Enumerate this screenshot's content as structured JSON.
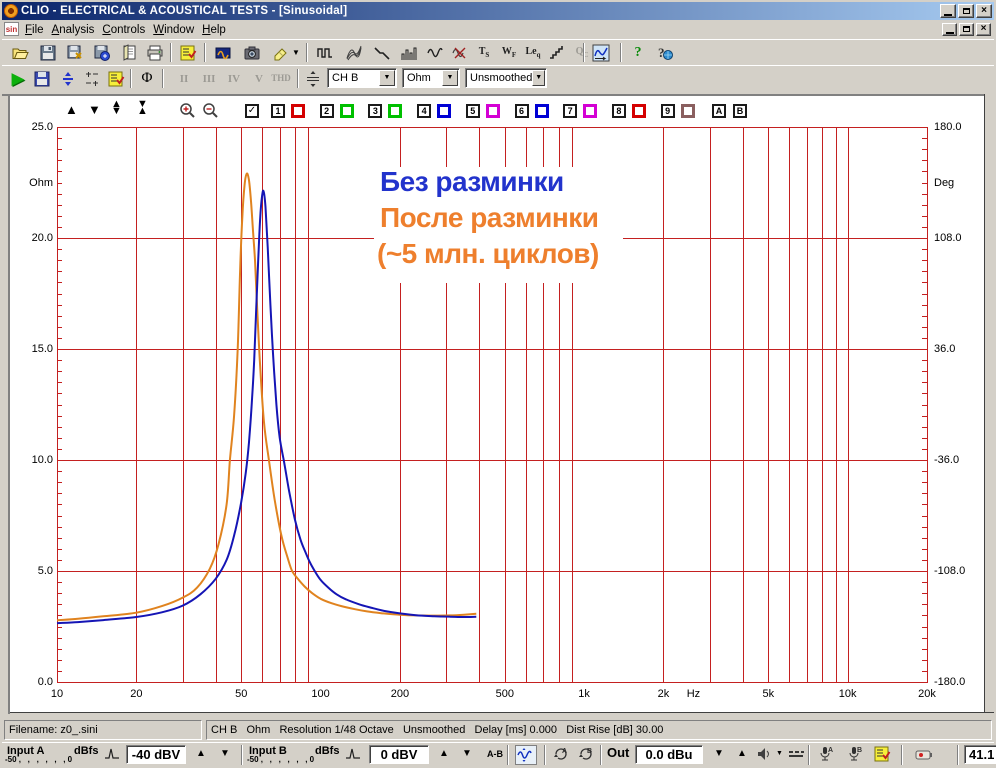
{
  "window": {
    "title": "CLIO - ELECTRICAL & ACOUSTICAL TESTS - [Sinusoidal]"
  },
  "menu": {
    "items": [
      "File",
      "Analysis",
      "Controls",
      "Window",
      "Help"
    ]
  },
  "toolbar1": {
    "icons": [
      "open-document",
      "save-file",
      "save-as",
      "export-file",
      "print-preview",
      "print",
      "measurement-notes",
      "multimeter",
      "snapshot",
      "erase",
      "erase-dropdown",
      "mls-analysis",
      "waterfall-analysis",
      "decay-analysis",
      "rta-analysis",
      "sinusoidal-analysis",
      "distortion-analysis",
      "t-s-parameters",
      "wow-flutter",
      "leq-analysis",
      "linearity-steps",
      "quality-control",
      "sinusoidal-active",
      "help",
      "help-about"
    ],
    "text_icons": {
      "ts": "Ts",
      "wf": "WF",
      "leq": "Leq",
      "qc": "Qc"
    }
  },
  "toolbar2": {
    "icons": [
      "start-measurement",
      "autosave",
      "autoscale",
      "scale-settings",
      "sin-settings",
      "phase",
      "harmonic-2",
      "harmonic-3",
      "harmonic-4",
      "harmonic-5",
      "thd",
      "split-scale"
    ],
    "text_icons": {
      "h2": "II",
      "h3": "III",
      "h4": "IV",
      "h5": "V",
      "thd": "THD"
    },
    "combos": {
      "channel": "CH B",
      "unit": "Ohm",
      "smoothing": "Unsmoothed"
    }
  },
  "chart_toolbar": {
    "curve_slots": [
      {
        "num": "1",
        "color": "#d40000"
      },
      {
        "num": "2",
        "color": "#00c000"
      },
      {
        "num": "3",
        "color": "#00c000"
      },
      {
        "num": "4",
        "color": "#0000d4"
      },
      {
        "num": "5",
        "color": "#d400d4"
      },
      {
        "num": "6",
        "color": "#0000d4"
      },
      {
        "num": "7",
        "color": "#d400d4"
      },
      {
        "num": "8",
        "color": "#d40000"
      },
      {
        "num": "9",
        "color": "#8a5f5f"
      }
    ],
    "ab_slots": [
      "A",
      "B"
    ],
    "check_all": "✓"
  },
  "chart_data": {
    "type": "line",
    "x_axis": {
      "label": "Hz",
      "scale": "log",
      "min": 10,
      "max": 20000,
      "display_labels": [
        {
          "text": "10",
          "f": 10
        },
        {
          "text": "20",
          "f": 20
        },
        {
          "text": "50",
          "f": 50
        },
        {
          "text": "100",
          "f": 100
        },
        {
          "text": "200",
          "f": 200
        },
        {
          "text": "500",
          "f": 500
        },
        {
          "text": "1k",
          "f": 1000
        },
        {
          "text": "2k",
          "f": 2000
        },
        {
          "text": "Hz",
          "f": 2600
        },
        {
          "text": "5k",
          "f": 5000
        },
        {
          "text": "10k",
          "f": 10000
        },
        {
          "text": "20k",
          "f": 20000
        }
      ]
    },
    "y_left": {
      "label": "Ohm",
      "min": 0,
      "max": 25,
      "labels": [
        {
          "text": "25.0",
          "v": 25
        },
        {
          "text": "20.0",
          "v": 20
        },
        {
          "text": "15.0",
          "v": 15
        },
        {
          "text": "10.0",
          "v": 10
        },
        {
          "text": "5.0",
          "v": 5
        },
        {
          "text": "0.0",
          "v": 0
        }
      ]
    },
    "y_right": {
      "label": "Deg",
      "min": -180,
      "max": 180,
      "labels": [
        {
          "text": "180.0",
          "v": 180
        },
        {
          "text": "108.0",
          "v": 108
        },
        {
          "text": "36.0",
          "v": 36
        },
        {
          "text": "-36.0",
          "v": -36
        },
        {
          "text": "-108.0",
          "v": -108
        },
        {
          "text": "-180.0",
          "v": -180
        }
      ]
    },
    "grid_color": "#c42020",
    "series": [
      {
        "name": "После разминки (~5 млн. циклов)",
        "color": "#e0831f",
        "points": [
          [
            10,
            2.78
          ],
          [
            12,
            2.85
          ],
          [
            15,
            2.96
          ],
          [
            20,
            3.12
          ],
          [
            25,
            3.42
          ],
          [
            30,
            3.8
          ],
          [
            34,
            4.25
          ],
          [
            38,
            5.1
          ],
          [
            41,
            6.2
          ],
          [
            44,
            8.0
          ],
          [
            45.3,
            10
          ],
          [
            47,
            12
          ],
          [
            48.5,
            15
          ],
          [
            49.5,
            18.5
          ],
          [
            50.5,
            21
          ],
          [
            51.5,
            22.4
          ],
          [
            52.5,
            22.9
          ],
          [
            53.5,
            22.6
          ],
          [
            54.5,
            21.6
          ],
          [
            55.5,
            20.2
          ],
          [
            56.4,
            19
          ],
          [
            57.5,
            16.8
          ],
          [
            59,
            14.2
          ],
          [
            61,
            11.7
          ],
          [
            63.7,
            10
          ],
          [
            67,
            8.2
          ],
          [
            71,
            6.6
          ],
          [
            75,
            5.6
          ],
          [
            78,
            5.0
          ],
          [
            82,
            4.65
          ],
          [
            87,
            4.3
          ],
          [
            93,
            4.0
          ],
          [
            100,
            3.75
          ],
          [
            110,
            3.55
          ],
          [
            120,
            3.42
          ],
          [
            135,
            3.28
          ],
          [
            150,
            3.18
          ],
          [
            170,
            3.1
          ],
          [
            200,
            3.03
          ],
          [
            230,
            3.0
          ],
          [
            270,
            2.99
          ],
          [
            310,
            3.0
          ],
          [
            350,
            3.03
          ],
          [
            390,
            3.07
          ]
        ]
      },
      {
        "name": "Без разминки",
        "color": "#1515b5",
        "points": [
          [
            10,
            2.65
          ],
          [
            12,
            2.7
          ],
          [
            15,
            2.79
          ],
          [
            20,
            2.93
          ],
          [
            25,
            3.14
          ],
          [
            30,
            3.44
          ],
          [
            35,
            3.95
          ],
          [
            40,
            4.65
          ],
          [
            44,
            5.5
          ],
          [
            47,
            6.6
          ],
          [
            50,
            8.1
          ],
          [
            52,
            9.4
          ],
          [
            53.5,
            10.8
          ],
          [
            55,
            12.8
          ],
          [
            56,
            14.5
          ],
          [
            57,
            16.8
          ],
          [
            58,
            19
          ],
          [
            59,
            20.9
          ],
          [
            60,
            21.9
          ],
          [
            60.8,
            22.1
          ],
          [
            61.8,
            21.4
          ],
          [
            63,
            19.6
          ],
          [
            64.5,
            17
          ],
          [
            66,
            14.8
          ],
          [
            68,
            12.5
          ],
          [
            70,
            11
          ],
          [
            73,
            9.8
          ],
          [
            76,
            8.6
          ],
          [
            80,
            7.3
          ],
          [
            84,
            6.4
          ],
          [
            88,
            5.8
          ],
          [
            91,
            5.4
          ],
          [
            95,
            5.0
          ],
          [
            100,
            4.6
          ],
          [
            107,
            4.25
          ],
          [
            115,
            3.95
          ],
          [
            125,
            3.72
          ],
          [
            140,
            3.5
          ],
          [
            155,
            3.35
          ],
          [
            175,
            3.2
          ],
          [
            200,
            3.09
          ],
          [
            230,
            3.01
          ],
          [
            270,
            2.96
          ],
          [
            310,
            2.94
          ],
          [
            350,
            2.93
          ],
          [
            390,
            2.94
          ]
        ]
      }
    ]
  },
  "annotations": {
    "line1": {
      "text": "Без разминки",
      "color": "#2233cc"
    },
    "line2": {
      "text": "После разминки",
      "color": "#ee7f2d"
    },
    "line3": {
      "text": "(~5 млн. циклов)",
      "color": "#ee7f2d"
    }
  },
  "status": {
    "filename": "Filename: z0_.sini",
    "info": "CH B   Ohm   Resolution 1/48 Octave   Unsmoothed   Delay [ms] 0.000   Dist Rise [dB] 30.00"
  },
  "bottom": {
    "input_a": {
      "label": "Input A",
      "unit": "dBfs",
      "scale": "-50 ,   ,   ,   ,   ,   , 0",
      "value": "-40 dBV"
    },
    "input_b": {
      "label": "Input B",
      "unit": "dBfs",
      "scale": "-50 ,   ,   ,   ,   ,   , 0",
      "value": "0 dBV"
    },
    "ab": "A-B",
    "out": {
      "label": "Out",
      "value": "0.0 dBu"
    },
    "right_value": "41.1"
  }
}
